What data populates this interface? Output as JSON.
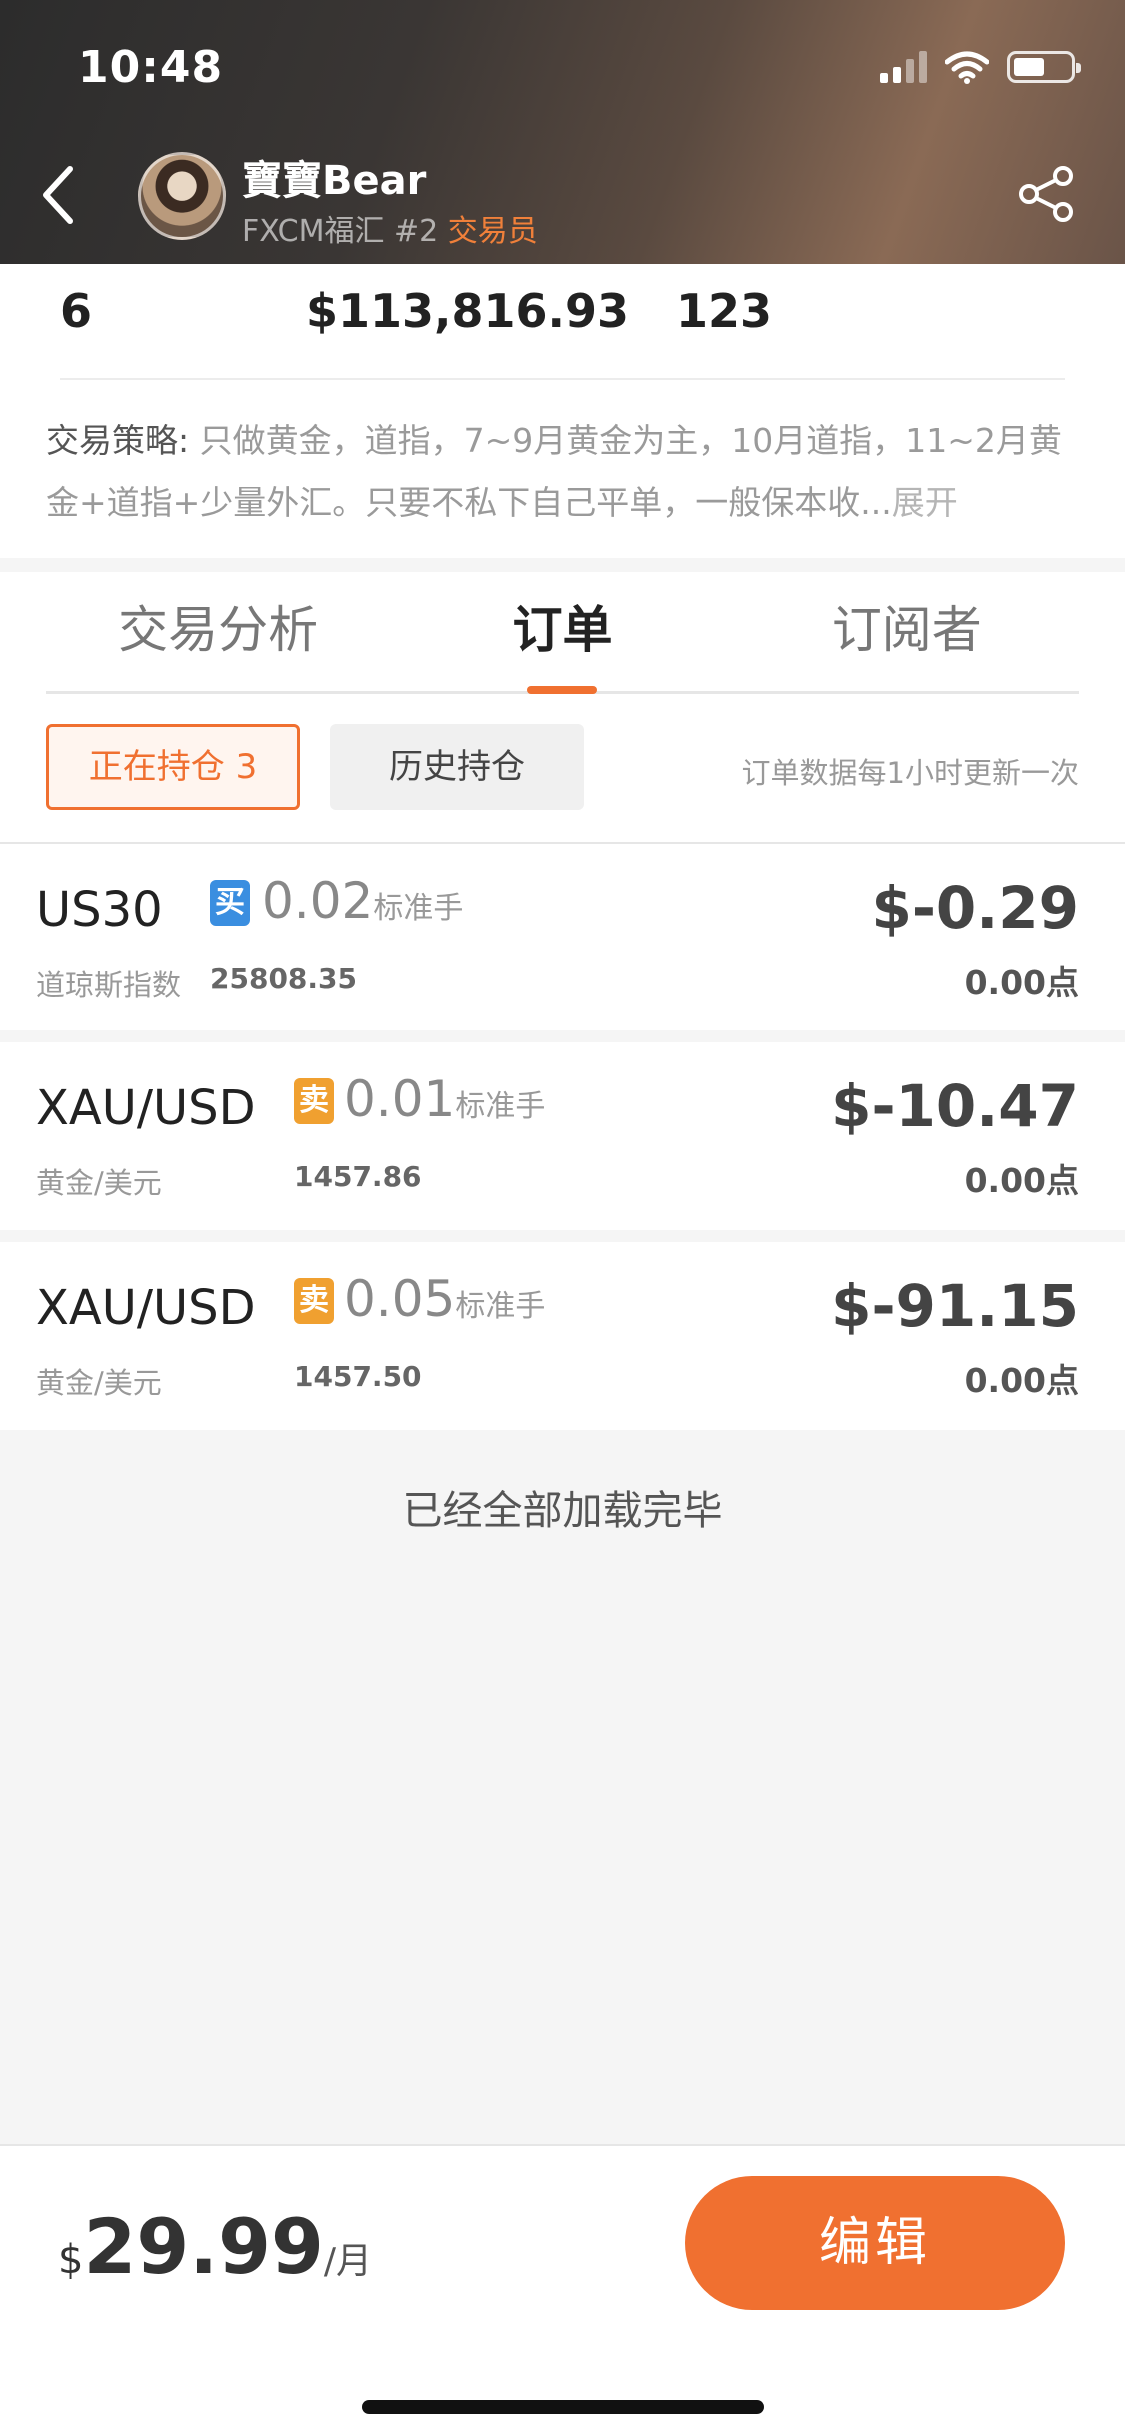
{
  "status_bar": {
    "time": "10:48"
  },
  "profile": {
    "name": "寶寶Bear",
    "broker": "FXCM福汇",
    "rank": "#2",
    "role": "交易员"
  },
  "stats": {
    "value_1": "6",
    "value_2": "$113,816.93",
    "value_3": "123"
  },
  "strategy": {
    "label": "交易策略:",
    "text": "只做黄金，道指，7~9月黄金为主，10月道指，11~2月黄金+道指+少量外汇。只要不私下自己平单，一般保本收...",
    "expand": "展开"
  },
  "tabs": [
    {
      "label": "交易分析"
    },
    {
      "label": "订单"
    },
    {
      "label": "订阅者"
    }
  ],
  "filters": {
    "active_label": "正在持仓 3",
    "history_label": "历史持仓",
    "update_note": "订单数据每1小时更新一次"
  },
  "orders": [
    {
      "symbol": "US30",
      "side": "买",
      "lots": "0.02",
      "unit": "标准手",
      "desc": "道琼斯指数",
      "price": "25808.35",
      "pnl": "$-0.29",
      "points": "0.00点"
    },
    {
      "symbol": "XAU/USD",
      "side": "卖",
      "lots": "0.01",
      "unit": "标准手",
      "desc": "黄金/美元",
      "price": "1457.86",
      "pnl": "$-10.47",
      "points": "0.00点"
    },
    {
      "symbol": "XAU/USD",
      "side": "卖",
      "lots": "0.05",
      "unit": "标准手",
      "desc": "黄金/美元",
      "price": "1457.50",
      "pnl": "$-91.15",
      "points": "0.00点"
    }
  ],
  "loaded_note": "已经全部加载完毕",
  "subscription": {
    "currency": "$",
    "amount": "29.99",
    "unit": "/月",
    "edit_label": "编辑"
  },
  "colors": {
    "accent": "#f07030",
    "buy": "#3a8ee0",
    "sell": "#f0a030"
  }
}
